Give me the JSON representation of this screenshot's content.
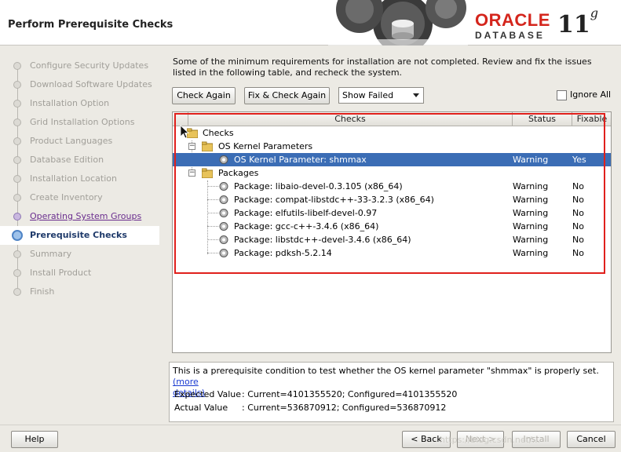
{
  "header": {
    "title": "Perform Prerequisite Checks",
    "brand_oracle": "ORACLE",
    "brand_database": "DATABASE",
    "brand_version": "11",
    "brand_version_suffix": "g"
  },
  "sidebar": {
    "steps": [
      {
        "label": "Configure Security Updates",
        "state": "done"
      },
      {
        "label": "Download Software Updates",
        "state": "done"
      },
      {
        "label": "Installation Option",
        "state": "done"
      },
      {
        "label": "Grid Installation Options",
        "state": "done"
      },
      {
        "label": "Product Languages",
        "state": "done"
      },
      {
        "label": "Database Edition",
        "state": "done"
      },
      {
        "label": "Installation Location",
        "state": "done"
      },
      {
        "label": "Create Inventory",
        "state": "done"
      },
      {
        "label": "Operating System Groups",
        "state": "link"
      },
      {
        "label": "Prerequisite Checks",
        "state": "current"
      },
      {
        "label": "Summary",
        "state": "pending"
      },
      {
        "label": "Install Product",
        "state": "pending"
      },
      {
        "label": "Finish",
        "state": "pending"
      }
    ]
  },
  "main": {
    "intro": "Some of the minimum requirements for installation are not completed. Review and fix the issues listed in the following table, and recheck the system.",
    "check_again_label": "Check Again",
    "fix_check_again_label": "Fix & Check Again",
    "filter_value": "Show Failed",
    "ignore_all_label": "Ignore All",
    "columns": {
      "checks": "Checks",
      "status": "Status",
      "fixable": "Fixable"
    },
    "tree": {
      "root": "Checks",
      "groups": [
        {
          "label": "OS Kernel Parameters",
          "items": [
            {
              "name": "OS Kernel Parameter: shmmax",
              "status": "Warning",
              "fixable": "Yes",
              "selected": true
            }
          ]
        },
        {
          "label": "Packages",
          "items": [
            {
              "name": "Package: libaio-devel-0.3.105 (x86_64)",
              "status": "Warning",
              "fixable": "No"
            },
            {
              "name": "Package: compat-libstdc++-33-3.2.3 (x86_64)",
              "status": "Warning",
              "fixable": "No"
            },
            {
              "name": "Package: elfutils-libelf-devel-0.97",
              "status": "Warning",
              "fixable": "No"
            },
            {
              "name": "Package: gcc-c++-3.4.6 (x86_64)",
              "status": "Warning",
              "fixable": "No"
            },
            {
              "name": "Package: libstdc++-devel-3.4.6 (x86_64)",
              "status": "Warning",
              "fixable": "No"
            },
            {
              "name": "Package: pdksh-5.2.14",
              "status": "Warning",
              "fixable": "No"
            }
          ]
        }
      ]
    },
    "detail": {
      "text": "This is a prerequisite condition to test whether the OS kernel parameter \"shmmax\" is properly set.",
      "more_open": "(more",
      "more_close": "details)",
      "expected_label": "Expected Value",
      "expected_value": ": Current=4101355520; Configured=4101355520",
      "actual_label": "Actual Value",
      "actual_value": ": Current=536870912; Configured=536870912"
    }
  },
  "footer": {
    "help_label": "Help",
    "back_label": "< Back",
    "next_label": "Next >",
    "install_label": "Install",
    "cancel_label": "Cancel",
    "watermark": "https://blog.csdn.net/..."
  },
  "colors": {
    "selection": "#3b6db5",
    "annotation_box": "#e0201c",
    "link": "#6a2d8e"
  }
}
